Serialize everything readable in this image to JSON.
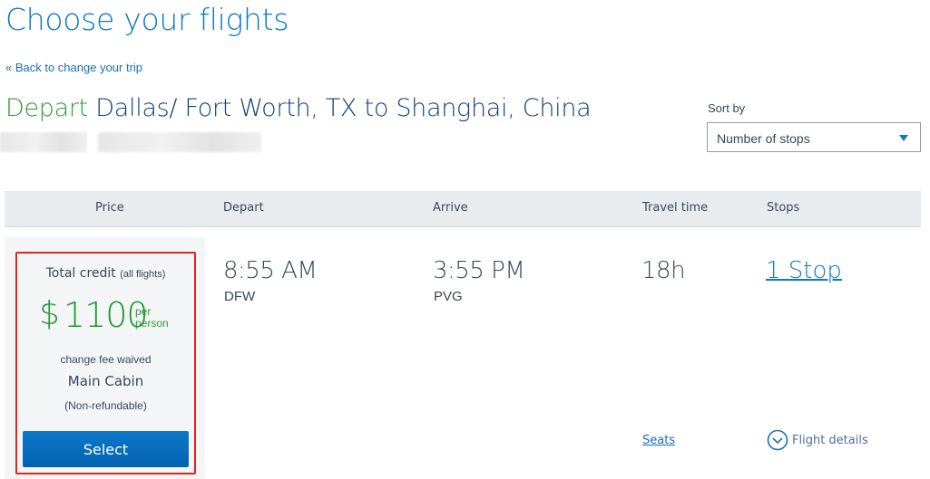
{
  "page": {
    "title": "Choose your flights",
    "back_link": "« Back to change your trip"
  },
  "route": {
    "depart_word": "Depart",
    "description": "Dallas/ Fort Worth, TX to Shanghai, China"
  },
  "sort": {
    "label": "Sort by",
    "selected": "Number of stops"
  },
  "table": {
    "columns": [
      "Price",
      "Depart",
      "Arrive",
      "Travel time",
      "Stops"
    ]
  },
  "flight": {
    "price": {
      "label": "Total credit",
      "label_note": "(all flights)",
      "currency": "$",
      "amount": "1100",
      "per_line1": "per",
      "per_line2": "person",
      "fee_note": "change fee waived",
      "cabin": "Main Cabin",
      "refund": "(Non-refundable)",
      "select_label": "Select"
    },
    "depart": {
      "time": "8:55 AM",
      "airport": "DFW"
    },
    "arrive": {
      "time": "3:55 PM",
      "airport": "PVG"
    },
    "travel_time": "18h",
    "stops": "1 Stop",
    "seats_link": "Seats",
    "details_link": "Flight details"
  },
  "colors": {
    "brand_blue": "#0b78c9",
    "price_green": "#1f9a2c",
    "highlight_red": "#e3241c"
  }
}
